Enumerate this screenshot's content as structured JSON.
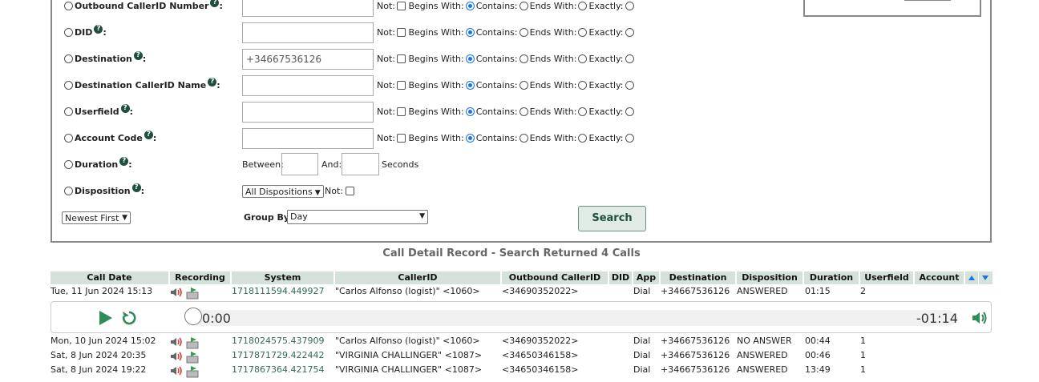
{
  "filters": [
    {
      "label": "Outbound CallerID Number",
      "suffix": ":",
      "value": "",
      "placeholder": ""
    },
    {
      "label": "DID",
      "suffix": ":",
      "value": "",
      "placeholder": ""
    },
    {
      "label": "Destination",
      "suffix": ":",
      "value": "+34667536126",
      "placeholder": ""
    },
    {
      "label": "Destination CallerID Name",
      "suffix": ":",
      "value": "",
      "placeholder": ""
    },
    {
      "label": "Userfield",
      "suffix": ":",
      "value": "",
      "placeholder": ""
    },
    {
      "label": "Account Code",
      "suffix": ":",
      "value": "",
      "placeholder": ""
    }
  ],
  "match_labels": {
    "not": "Not:",
    "begins": "Begins With:",
    "contains": "Contains:",
    "ends": "Ends With:",
    "exactly": "Exactly:"
  },
  "duration": {
    "label": "Duration",
    "suffix": ":",
    "between": "Between:",
    "and": "And:",
    "seconds": "Seconds"
  },
  "disposition": {
    "label": "Disposition",
    "suffix": ":",
    "select_value": "All Dispositions",
    "not": "Not:"
  },
  "order": {
    "value": "Newest First"
  },
  "group_by": {
    "label": "Group By:",
    "value": "Day"
  },
  "search_button": "Search",
  "results_title": "Call Detail Record - Search Returned 4 Calls",
  "columns": [
    "Call Date",
    "Recording",
    "System",
    "CallerID",
    "Outbound CallerID",
    "DID",
    "App",
    "Destination",
    "Disposition",
    "Duration",
    "Userfield",
    "Account"
  ],
  "rows": [
    {
      "date": "Tue, 11 Jun 2024 15:13",
      "system": "1718111594.449927",
      "callerid": "\"Carlos Alfonso (logist)\" <1060>",
      "outbound": "<34690352022>",
      "did": "",
      "app": "Dial",
      "destination": "+34667536126",
      "disposition": "ANSWERED",
      "duration": "01:15",
      "userfield": "2",
      "account": ""
    },
    {
      "date": "Mon, 10 Jun 2024 15:02",
      "system": "1718024575.437909",
      "callerid": "\"Carlos Alfonso (logist)\" <1060>",
      "outbound": "<34690352022>",
      "did": "",
      "app": "Dial",
      "destination": "+34667536126",
      "disposition": "NO ANSWER",
      "duration": "00:44",
      "userfield": "1",
      "account": ""
    },
    {
      "date": "Sat, 8 Jun 2024 20:35",
      "system": "1717871729.422442",
      "callerid": "\"VIRGINIA CHALLINGER\" <1087>",
      "outbound": "<34650346158>",
      "did": "",
      "app": "Dial",
      "destination": "+34667536126",
      "disposition": "ANSWERED",
      "duration": "00:46",
      "userfield": "1",
      "account": ""
    },
    {
      "date": "Sat, 8 Jun 2024 19:22",
      "system": "1717867364.421754",
      "callerid": "\"VIRGINIA CHALLINGER\" <1087>",
      "outbound": "<34650346158>",
      "did": "",
      "app": "Dial",
      "destination": "+34667536126",
      "disposition": "ANSWERED",
      "duration": "13:49",
      "userfield": "1",
      "account": ""
    }
  ],
  "player": {
    "current_time": "0:00",
    "remaining_time": "-01:14",
    "progress": 0
  },
  "colors": {
    "accent": "#1e4e3e",
    "header_bg": "#d4e2da",
    "link": "#2f6b57",
    "radio_on": "#1a73e8"
  }
}
